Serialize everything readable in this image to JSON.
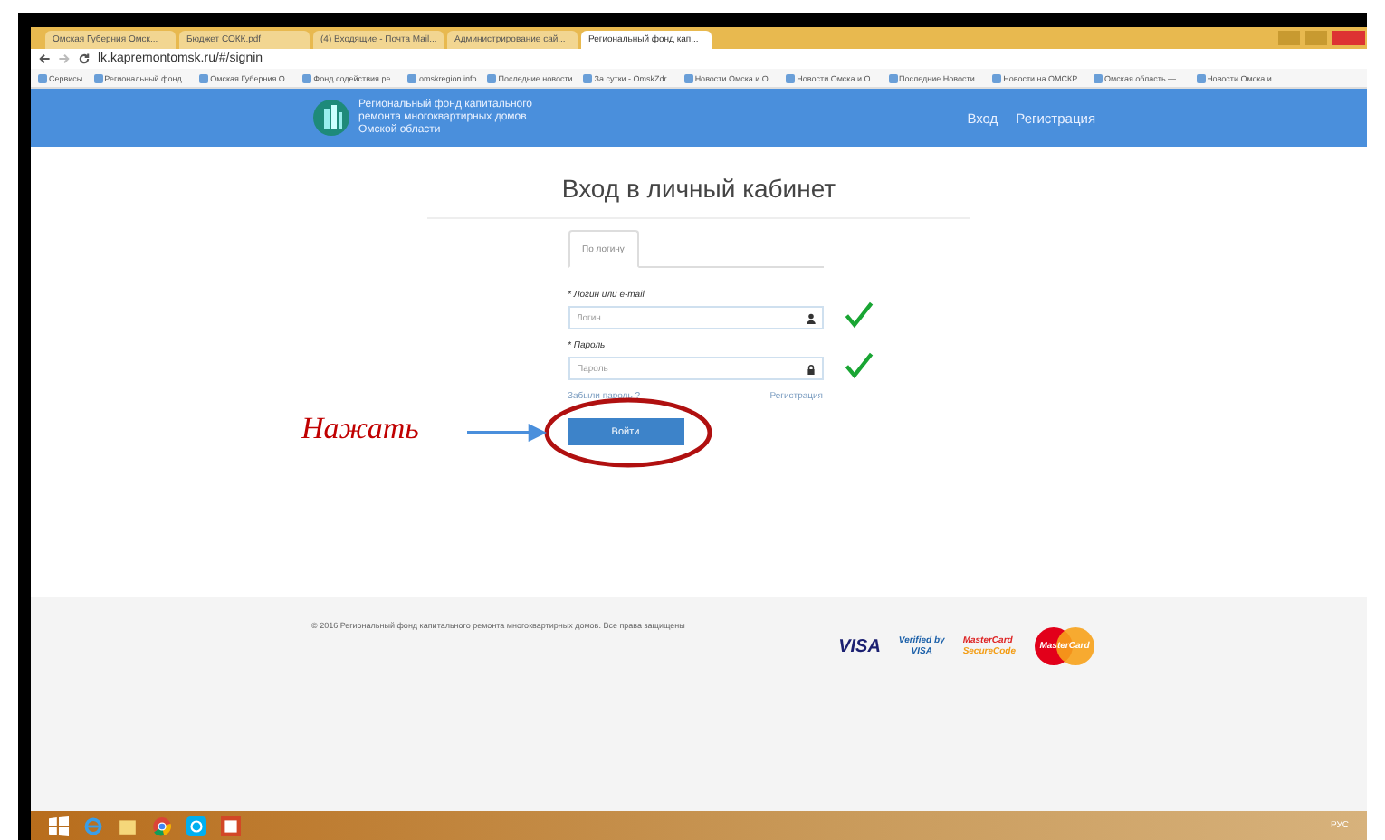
{
  "browser": {
    "tabs": [
      {
        "label": "Омская Губерния Омск...",
        "selected": false
      },
      {
        "label": "Бюджет СОКК.pdf",
        "selected": false
      },
      {
        "label": "(4) Входящие - Почта Mail...",
        "selected": false
      },
      {
        "label": "Администрирование сай...",
        "selected": false
      },
      {
        "label": "Региональный фонд кап...",
        "selected": true
      }
    ],
    "address": "lk.kapremontomsk.ru/#/signin",
    "bookmarks": [
      "Сервисы",
      "Региональный фонд...",
      "Омская Губерния О...",
      "Фонд содействия ре...",
      "omskregion.info",
      "Последние новости",
      "За сутки - OmskZdr...",
      "Новости Омска и О...",
      "Новости Омска и О...",
      "Последние Новости...",
      "Новости на ОМСКР...",
      "Омская область — ...",
      "Новости Омска и ..."
    ]
  },
  "site": {
    "org_name": [
      "Региональный фонд капитального",
      "ремонта многоквартирных домов",
      "Омской области"
    ],
    "nav": [
      "Вход",
      "Регистрация"
    ]
  },
  "login": {
    "title": "Вход в личный кабинет",
    "tabs": [
      {
        "label": "По логину",
        "selected": true
      }
    ],
    "fields": [
      {
        "kind": "text",
        "label": "* Логин или e-mail",
        "placeholder": "Логин",
        "checked": true
      },
      {
        "kind": "password",
        "label": "* Пароль",
        "placeholder": "Пароль",
        "checked": true
      }
    ],
    "forgot_link": "Забыли пароль ?",
    "register_link": "Регистрация",
    "submit": "Войти"
  },
  "annotation": {
    "text": "Нажать"
  },
  "footer": {
    "copyright": "© 2016 Региональный фонд капитального ремонта многоквартирных домов. Все права защищены",
    "payment_logos": [
      {
        "kind": "visa",
        "lines": [
          "VISA"
        ]
      },
      {
        "kind": "verified",
        "lines": [
          "Verified by",
          "VISA"
        ]
      },
      {
        "kind": "securecode",
        "lines": [
          "MasterCard",
          "SecureCode"
        ]
      },
      {
        "kind": "mastercard",
        "lines": [
          "MasterCard"
        ]
      }
    ]
  },
  "taskbar": {
    "language": "РУС"
  }
}
